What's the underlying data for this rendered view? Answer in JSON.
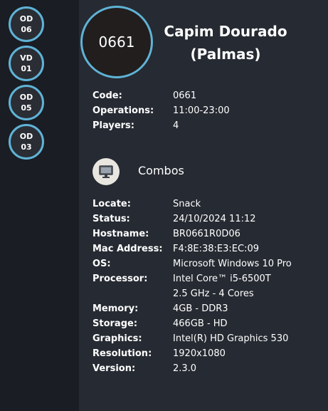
{
  "sidebar": {
    "badges": [
      {
        "top": "OD",
        "bottom": "06"
      },
      {
        "top": "VD",
        "bottom": "01"
      },
      {
        "top": "OD",
        "bottom": "05"
      },
      {
        "top": "OD",
        "bottom": "03"
      }
    ]
  },
  "store": {
    "code_badge": "0661",
    "name_line1": "Capim Dourado",
    "name_line2": "(Palmas)",
    "fields": {
      "code": {
        "label": "Code:",
        "value": "0661"
      },
      "operations": {
        "label": "Operations:",
        "value": "11:00-23:00"
      },
      "players": {
        "label": "Players:",
        "value": "4"
      }
    }
  },
  "device": {
    "section_label": "Combos",
    "icon": "monitor-icon",
    "fields": {
      "locate": {
        "label": "Locate:",
        "value": "Snack"
      },
      "status": {
        "label": "Status:",
        "value": "24/10/2024 11:12"
      },
      "hostname": {
        "label": "Hostname:",
        "value": "BR0661R0D06"
      },
      "mac": {
        "label": "Mac Address:",
        "value": "F4:8E:38:E3:EC:09"
      },
      "os": {
        "label": "OS:",
        "value": "Microsoft Windows 10 Pro"
      },
      "processor": {
        "label": "Processor:",
        "value": "Intel Core™ i5-6500T"
      },
      "processor2": {
        "value": "2.5 GHz - 4 Cores"
      },
      "memory": {
        "label": "Memory:",
        "value": "4GB - DDR3"
      },
      "storage": {
        "label": "Storage:",
        "value": "466GB - HD"
      },
      "graphics": {
        "label": "Graphics:",
        "value": "Intel(R) HD Graphics 530"
      },
      "resolution": {
        "label": "Resolution:",
        "value": "1920x1080"
      },
      "version": {
        "label": "Version:",
        "value": "2.3.0"
      }
    }
  },
  "colors": {
    "accent": "#5fb3d6",
    "background": "#1a1d24",
    "panel": "#262a32"
  }
}
